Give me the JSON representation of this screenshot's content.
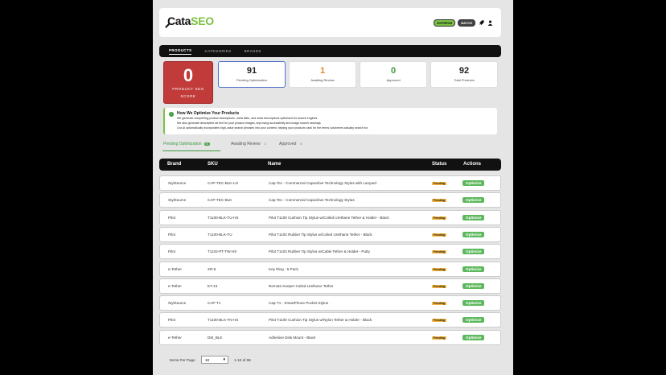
{
  "header": {
    "logo_main": "Cata",
    "logo_accent": "SEO",
    "express_label": "EXPRESS",
    "batch_label": "BATCH"
  },
  "nav": {
    "tabs": [
      {
        "label": "PRODUCTS",
        "active": true
      },
      {
        "label": "CATEGORIES",
        "active": false
      },
      {
        "label": "BRANDS",
        "active": false
      }
    ]
  },
  "seo_score": {
    "value": "0",
    "label_line1": "PRODUCT SEO",
    "label_line2": "SCORE"
  },
  "stats": [
    {
      "value": "91",
      "label": "Pending Optimization",
      "color": "#222222"
    },
    {
      "value": "1",
      "label": "Awaiting Review",
      "color": "#e0882a"
    },
    {
      "value": "0",
      "label": "Approved",
      "color": "#3c9a3c"
    },
    {
      "value": "92",
      "label": "Total Products",
      "color": "#222222"
    }
  ],
  "info": {
    "title": "How We Optimize Your Products",
    "lines": [
      "We generate compelling product descriptions, meta titles, and meta descriptions optimized for search engines.",
      "We also generate descriptive alt text for your product images, improving accessibility and image search rankings.",
      "Our AI automatically incorporates high-value search phrases into your content, helping your products rank for the terms customers actually search for."
    ]
  },
  "subtabs": [
    {
      "label": "Pending Optimization",
      "count": "91"
    },
    {
      "label": "Awaiting Review",
      "count": "1"
    },
    {
      "label": "Approved",
      "count": "0"
    }
  ],
  "table": {
    "headers": {
      "brand": "Brand",
      "sku": "SKU",
      "name": "Name",
      "status": "Status",
      "actions": "Actions"
    },
    "rows": [
      {
        "brand": "StylSource",
        "sku": "CAP-TEC-BLK-LN",
        "name": "Cap-Tec - Commercial Capacitive Technology Stylus with Lanyard",
        "status": "Pending",
        "action": "Optimize"
      },
      {
        "brand": "StylSource",
        "sku": "CAP-TEC-BLK",
        "name": "Cap-Tec - Commercial Capacitive Technology Stylus",
        "status": "Pending",
        "action": "Optimize"
      },
      {
        "brand": "Pilot",
        "sku": "T1100-BLK-TU-HS",
        "name": "Pilot T1100 Cushion Tip Stylus w/Coiled Urethane Tether & Holder - Black",
        "status": "Pending",
        "action": "Optimize"
      },
      {
        "brand": "Pilot",
        "sku": "T1100-BLK-TU",
        "name": "Pilot T1102 Rubber Tip Stylus w/Coiled Urethane Tether - Black",
        "status": "Pending",
        "action": "Optimize"
      },
      {
        "brand": "Pilot",
        "sku": "T1102-PT-TW-HS",
        "name": "Pilot T1102 Rubber Tip Stylus w/Cable Tether & Holder - Putty",
        "status": "Pending",
        "action": "Optimize"
      },
      {
        "brand": "e-Tether",
        "sku": "XR-5",
        "name": "Key Ring - 5 Pack",
        "status": "Pending",
        "action": "Optimize"
      },
      {
        "brand": "e-Tether",
        "sku": "ET-44",
        "name": "Remote Keeper Coiled Urethane Tether",
        "status": "Pending",
        "action": "Optimize"
      },
      {
        "brand": "StylSource",
        "sku": "CAP-T1",
        "name": "Cap-T1 - SmartPhone Pocket Stylus",
        "status": "Pending",
        "action": "Optimize"
      },
      {
        "brand": "Pilot",
        "sku": "T1100-BLK-TN-HS",
        "name": "Pilot T1100 Cushion Tip Stylus w/Nylon Tether & Holder - Black",
        "status": "Pending",
        "action": "Optimize"
      },
      {
        "brand": "e-Tether",
        "sku": "DM_BLK",
        "name": "Adhesive Disk Mount - Black",
        "status": "Pending",
        "action": "Optimize"
      }
    ]
  },
  "pager": {
    "items_per_page_label": "Items Per Page",
    "items_per_page": "10",
    "range": "1-10 of 88"
  }
}
